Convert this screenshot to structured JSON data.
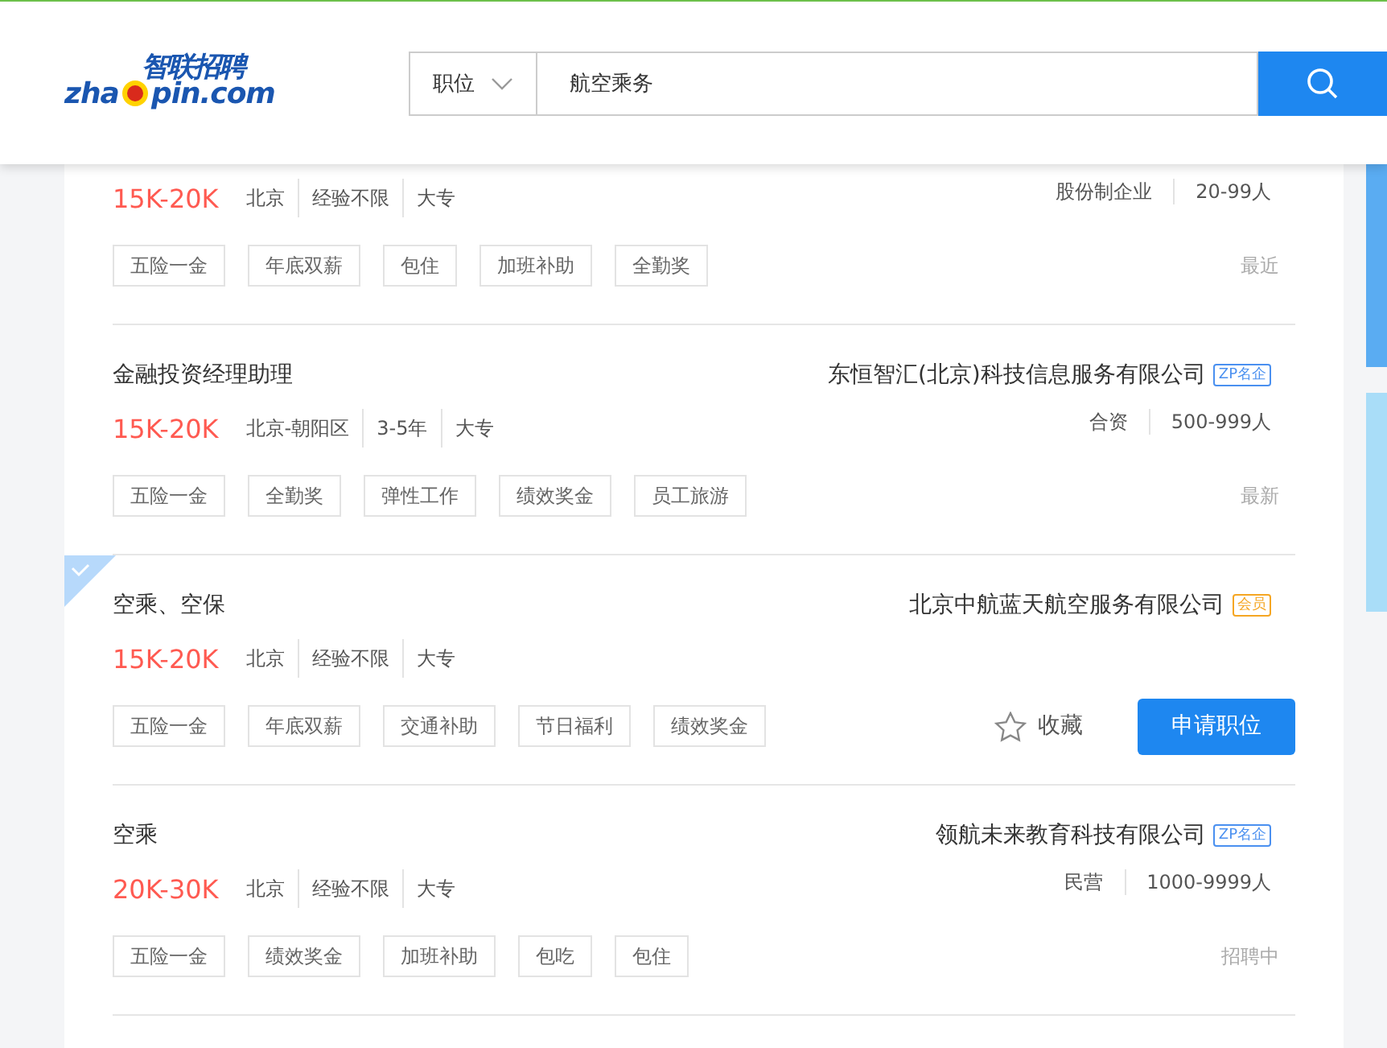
{
  "header": {
    "logo_cn": "智联招聘",
    "logo_en_1": "zha",
    "logo_en_2": "pin.com",
    "search": {
      "category": "职位",
      "value": "航空乘务"
    }
  },
  "jobs": [
    {
      "checked": false,
      "salary": "15K-20K",
      "info": [
        "北京",
        "经验不限",
        "大专"
      ],
      "company_meta": [
        "股份制企业",
        "20-99人"
      ],
      "tags": [
        "五险一金",
        "年底双薪",
        "包住",
        "加班补助",
        "全勤奖"
      ],
      "status": "最近"
    },
    {
      "checked": false,
      "title": "金融投资经理助理",
      "company": "东恒智汇(北京)科技信息服务有限公司",
      "badge": {
        "text": "ZP名企",
        "color": "#4a90f0"
      },
      "salary": "15K-20K",
      "info": [
        "北京-朝阳区",
        "3-5年",
        "大专"
      ],
      "company_meta": [
        "合资",
        "500-999人"
      ],
      "tags": [
        "五险一金",
        "全勤奖",
        "弹性工作",
        "绩效奖金",
        "员工旅游"
      ],
      "status": "最新"
    },
    {
      "checked": true,
      "title": "空乘、空保",
      "company": "北京中航蓝天航空服务有限公司",
      "badge": {
        "text": "会员",
        "color": "#f5a623"
      },
      "salary": "15K-20K",
      "info": [
        "北京",
        "经验不限",
        "大专"
      ],
      "tags": [
        "五险一金",
        "年底双薪",
        "交通补助",
        "节日福利",
        "绩效奖金"
      ],
      "favorite": "收藏",
      "apply": "申请职位"
    },
    {
      "checked": false,
      "title": "空乘",
      "company": "领航未来教育科技有限公司",
      "badge": {
        "text": "ZP名企",
        "color": "#4a90f0"
      },
      "salary": "20K-30K",
      "info": [
        "北京",
        "经验不限",
        "大专"
      ],
      "company_meta": [
        "民营",
        "1000-9999人"
      ],
      "tags": [
        "五险一金",
        "绩效奖金",
        "加班补助",
        "包吃",
        "包住"
      ],
      "status": "招聘中"
    }
  ]
}
